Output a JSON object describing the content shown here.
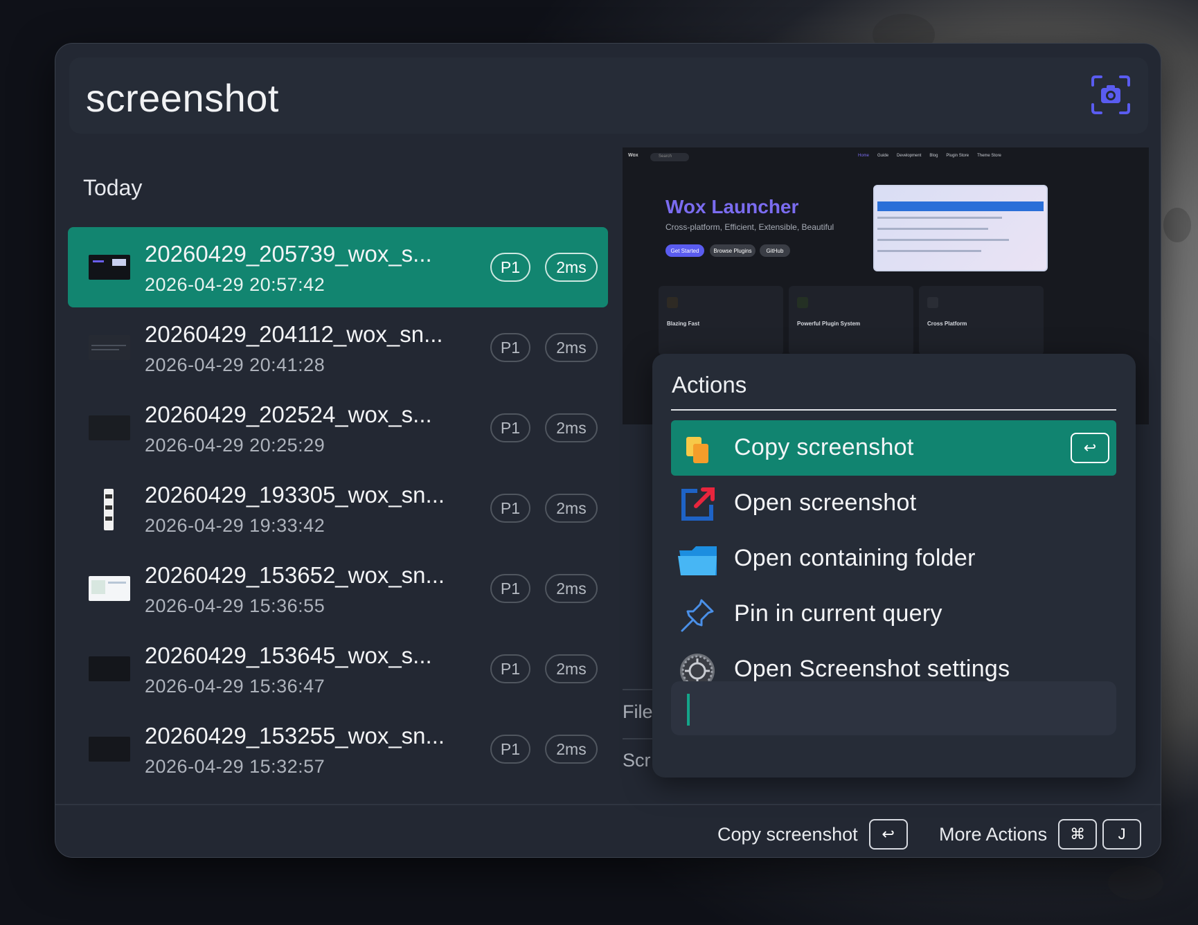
{
  "query": {
    "text": "screenshot",
    "icon": "camera-icon",
    "accent": "#5a5cf0"
  },
  "group": {
    "title": "Today"
  },
  "results": [
    {
      "title": "20260429_205739_wox_s...",
      "subtitle": "2026-04-29 20:57:42",
      "tag1": "P1",
      "tag2": "2ms",
      "active": true
    },
    {
      "title": "20260429_204112_wox_sn...",
      "subtitle": "2026-04-29 20:41:28",
      "tag1": "P1",
      "tag2": "2ms"
    },
    {
      "title": "20260429_202524_wox_s...",
      "subtitle": "2026-04-29 20:25:29",
      "tag1": "P1",
      "tag2": "2ms"
    },
    {
      "title": "20260429_193305_wox_sn...",
      "subtitle": "2026-04-29 19:33:42",
      "tag1": "P1",
      "tag2": "2ms"
    },
    {
      "title": "20260429_153652_wox_sn...",
      "subtitle": "2026-04-29 15:36:55",
      "tag1": "P1",
      "tag2": "2ms"
    },
    {
      "title": "20260429_153645_wox_s...",
      "subtitle": "2026-04-29 15:36:47",
      "tag1": "P1",
      "tag2": "2ms"
    },
    {
      "title": "20260429_153255_wox_sn...",
      "subtitle": "2026-04-29 15:32:57",
      "tag1": "P1",
      "tag2": "2ms"
    }
  ],
  "preview": {
    "title": "Wox Launcher",
    "subtitle": "Cross-platform, Efficient, Extensible, Beautiful",
    "buttons": [
      "Get Started",
      "Browse Plugins",
      "GitHub"
    ],
    "nav": [
      "Home",
      "Guide",
      "Development",
      "Blog",
      "Plugin Store",
      "Theme Store"
    ],
    "cards": [
      "Blazing Fast",
      "Powerful Plugin System",
      "Cross Platform"
    ],
    "logo": "Wox",
    "search": "Search"
  },
  "details": {
    "file_label": "File",
    "scr_label": "Scr"
  },
  "actions": {
    "title": "Actions",
    "items": [
      {
        "label": "Copy screenshot",
        "icon": "copy-icon",
        "key": "↩",
        "active": true
      },
      {
        "label": "Open screenshot",
        "icon": "open-external-icon"
      },
      {
        "label": "Open containing folder",
        "icon": "folder-icon"
      },
      {
        "label": "Pin in current query",
        "icon": "pin-icon"
      },
      {
        "label": "Open Screenshot settings",
        "icon": "settings-gear-icon"
      }
    ],
    "filter_value": ""
  },
  "footer": {
    "primary_label": "Copy screenshot",
    "primary_key": "↩",
    "more_label": "More Actions",
    "more_key1": "⌘",
    "more_key2": "J"
  },
  "colors": {
    "selection": "#128570",
    "window_bg": "#232833",
    "panel_bg": "#262c37"
  }
}
